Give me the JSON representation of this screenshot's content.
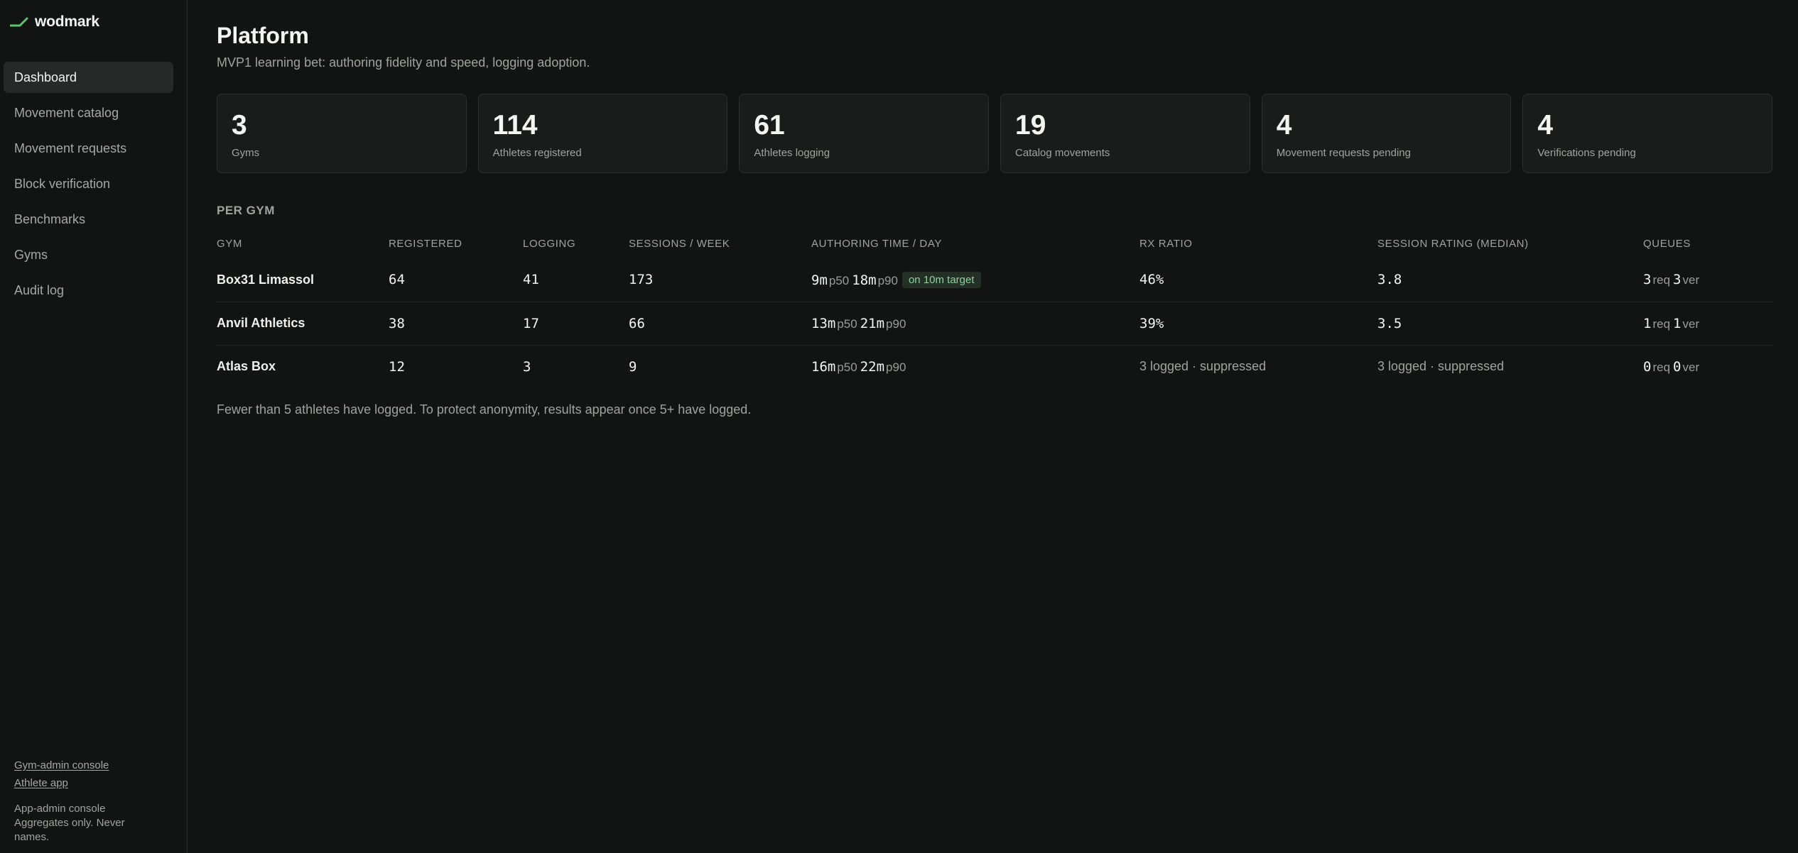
{
  "app": {
    "name": "wodmark",
    "accent": "#5fc46f"
  },
  "nav": [
    {
      "label": "Dashboard",
      "active": true
    },
    {
      "label": "Movement catalog"
    },
    {
      "label": "Movement requests"
    },
    {
      "label": "Block verification"
    },
    {
      "label": "Benchmarks"
    },
    {
      "label": "Gyms"
    },
    {
      "label": "Audit log"
    }
  ],
  "footer": {
    "links": [
      "Gym-admin console",
      "Athlete app"
    ],
    "note": "App-admin console Aggregates only. Never names."
  },
  "page": {
    "title": "Platform",
    "subtitle": "MVP1 learning bet: authoring fidelity and speed, logging adoption."
  },
  "stats": [
    {
      "value": "3",
      "label": "Gyms"
    },
    {
      "value": "114",
      "label": "Athletes registered"
    },
    {
      "value": "61",
      "label": "Athletes logging"
    },
    {
      "value": "19",
      "label": "Catalog movements"
    },
    {
      "value": "4",
      "label": "Movement requests pending"
    },
    {
      "value": "4",
      "label": "Verifications pending"
    }
  ],
  "per_gym": {
    "title": "PER GYM",
    "columns": [
      "GYM",
      "REGISTERED",
      "LOGGING",
      "SESSIONS / WEEK",
      "AUTHORING TIME / DAY",
      "RX RATIO",
      "SESSION RATING (MEDIAN)",
      "QUEUES"
    ],
    "units": {
      "p50": "p50",
      "p90": "p90",
      "req": "req",
      "ver": "ver"
    },
    "rows": [
      {
        "gym": "Box31 Limassol",
        "registered": "64",
        "logging": "41",
        "sessions": "173",
        "p50": "9m",
        "p90": "18m",
        "badge": "on 10m target",
        "rx": "46%",
        "rating": "3.8",
        "req": "3",
        "ver": "3"
      },
      {
        "gym": "Anvil Athletics",
        "registered": "38",
        "logging": "17",
        "sessions": "66",
        "p50": "13m",
        "p90": "21m",
        "rx": "39%",
        "rating": "3.5",
        "req": "1",
        "ver": "1"
      },
      {
        "gym": "Atlas Box",
        "registered": "12",
        "logging": "3",
        "sessions": "9",
        "p50": "16m",
        "p90": "22m",
        "rx_text": "3 logged · suppressed",
        "rating_text": "3 logged · suppressed",
        "req": "0",
        "ver": "0"
      }
    ],
    "note": "Fewer than 5 athletes have logged. To protect anonymity, results appear once 5+ have logged."
  }
}
